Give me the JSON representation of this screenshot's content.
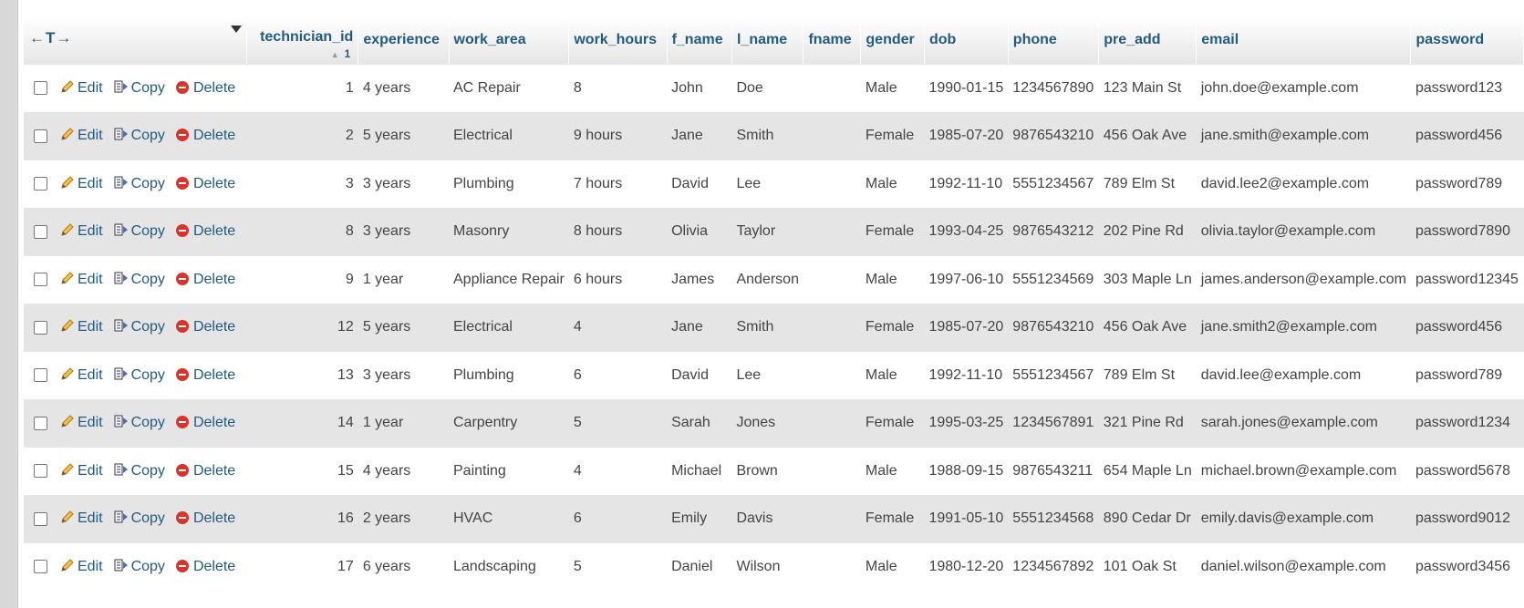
{
  "table": {
    "nav_arrows": "←T→",
    "columns": [
      "technician_id",
      "experience",
      "work_area",
      "work_hours",
      "f_name",
      "l_name",
      "fname",
      "gender",
      "dob",
      "phone",
      "pre_add",
      "email",
      "password"
    ],
    "sort_indicator": "1",
    "actions": {
      "edit": "Edit",
      "copy": "Copy",
      "delete": "Delete"
    },
    "rows": [
      [
        "1",
        "4 years",
        "AC Repair",
        "8",
        "John",
        "Doe",
        "",
        "Male",
        "1990-01-15",
        "1234567890",
        "123 Main St",
        "john.doe@example.com",
        "password123"
      ],
      [
        "2",
        "5 years",
        "Electrical",
        "9 hours",
        "Jane",
        "Smith",
        "",
        "Female",
        "1985-07-20",
        "9876543210",
        "456 Oak Ave",
        "jane.smith@example.com",
        "password456"
      ],
      [
        "3",
        "3 years",
        "Plumbing",
        "7 hours",
        "David",
        "Lee",
        "",
        "Male",
        "1992-11-10",
        "5551234567",
        "789 Elm St",
        "david.lee2@example.com",
        "password789"
      ],
      [
        "8",
        "3 years",
        "Masonry",
        "8 hours",
        "Olivia",
        "Taylor",
        "",
        "Female",
        "1993-04-25",
        "9876543212",
        "202 Pine Rd",
        "olivia.taylor@example.com",
        "password7890"
      ],
      [
        "9",
        "1 year",
        "Appliance Repair",
        "6 hours",
        "James",
        "Anderson",
        "",
        "Male",
        "1997-06-10",
        "5551234569",
        "303 Maple Ln",
        "james.anderson@example.com",
        "password12345"
      ],
      [
        "12",
        "5 years",
        "Electrical",
        "4",
        "Jane",
        "Smith",
        "",
        "Female",
        "1985-07-20",
        "9876543210",
        "456 Oak Ave",
        "jane.smith2@example.com",
        "password456"
      ],
      [
        "13",
        "3 years",
        "Plumbing",
        "6",
        "David",
        "Lee",
        "",
        "Male",
        "1992-11-10",
        "5551234567",
        "789 Elm St",
        "david.lee@example.com",
        "password789"
      ],
      [
        "14",
        "1 year",
        "Carpentry",
        "5",
        "Sarah",
        "Jones",
        "",
        "Female",
        "1995-03-25",
        "1234567891",
        "321 Pine Rd",
        "sarah.jones@example.com",
        "password1234"
      ],
      [
        "15",
        "4 years",
        "Painting",
        "4",
        "Michael",
        "Brown",
        "",
        "Male",
        "1988-09-15",
        "9876543211",
        "654 Maple Ln",
        "michael.brown@example.com",
        "password5678"
      ],
      [
        "16",
        "2 years",
        "HVAC",
        "6",
        "Emily",
        "Davis",
        "",
        "Female",
        "1991-05-10",
        "5551234568",
        "890 Cedar Dr",
        "emily.davis@example.com",
        "password9012"
      ],
      [
        "17",
        "6 years",
        "Landscaping",
        "5",
        "Daniel",
        "Wilson",
        "",
        "Male",
        "1980-12-20",
        "1234567892",
        "101 Oak St",
        "daniel.wilson@example.com",
        "password3456"
      ]
    ]
  }
}
